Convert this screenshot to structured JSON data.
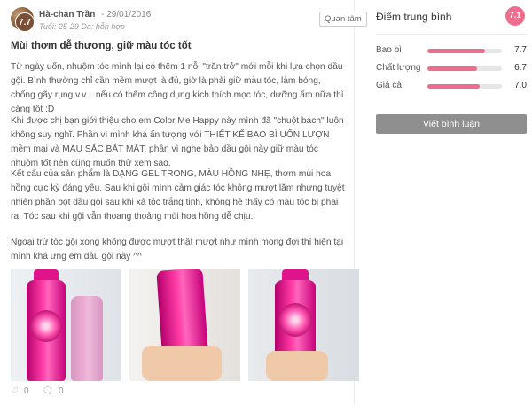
{
  "review": {
    "user": {
      "name": "Hà-chan Trần",
      "date": "- 29/01/2016",
      "meta": "Tuổi: 25-29 Da: hỗn hợp",
      "score": "7.7"
    },
    "follow_label": "Quan tâm",
    "title": "Mùi thơm dễ thương, giữ màu tóc tốt",
    "paragraphs": [
      "Từ ngày uốn, nhuộm tóc mình lại có thêm 1 nỗi \"trăn trở\" mới mỗi khi lựa chọn dầu gội. Bình thường chỉ cần mềm mượt là đủ, giờ là phải giữ màu tóc, làm bóng, chống gãy rụng v.v... nếu có thêm công dụng kích thích mọc tóc, dưỡng ẩm nữa thì càng tốt :D",
      "Khi được chị bạn giới thiệu cho em Color Me Happy này mình đã \"chuột bạch\" luôn không suy nghĩ. Phần vì mình khá ấn tượng với THIẾT KẾ BAO BÌ UỐN LƯỢN mềm mại và MÀU SẮC BẮT MẮT, phần vì nghe bảo dầu gội này giữ màu tóc nhuộm tốt nên cũng muốn thử xem sao.",
      "Kết cấu của sản phẩm là DẠNG GEL TRONG, MÀU HỒNG NHẸ, thơm mùi hoa hồng cực kỳ đáng yêu. Sau khi gội mình cảm giác tóc không mượt lắm nhưng tuyệt nhiên phần bọt dầu gội sau khi xả tóc trắng tinh, không hề thấy có màu tóc bị phai ra. Tóc sau khi gội vẫn thoang thoảng mùi hoa hồng dễ chịu.",
      "Ngoại trừ tóc gội xong không được mượt thật mượt như mình mong đợi thì hiện tại mình khá ưng em dầu gội này ^^"
    ],
    "photos": [
      "product-front-photo",
      "product-back-photo",
      "product-hand-photo"
    ],
    "likes": "0",
    "comments": "0"
  },
  "ratings": {
    "title": "Điểm trung bình",
    "average": "7.1",
    "items": [
      {
        "label": "Bao bì",
        "value": "7.7",
        "fraction": 0.77
      },
      {
        "label": "Chất lượng",
        "value": "6.7",
        "fraction": 0.67
      },
      {
        "label": "Giá cả",
        "value": "7.0",
        "fraction": 0.7
      }
    ],
    "write_review_label": "Viết bình luận"
  },
  "colors": {
    "accent": "#ee6d8e",
    "button_gray": "#8f8f8f"
  },
  "icons": {
    "like": "heart-icon",
    "comment": "speech-bubble-icon"
  }
}
